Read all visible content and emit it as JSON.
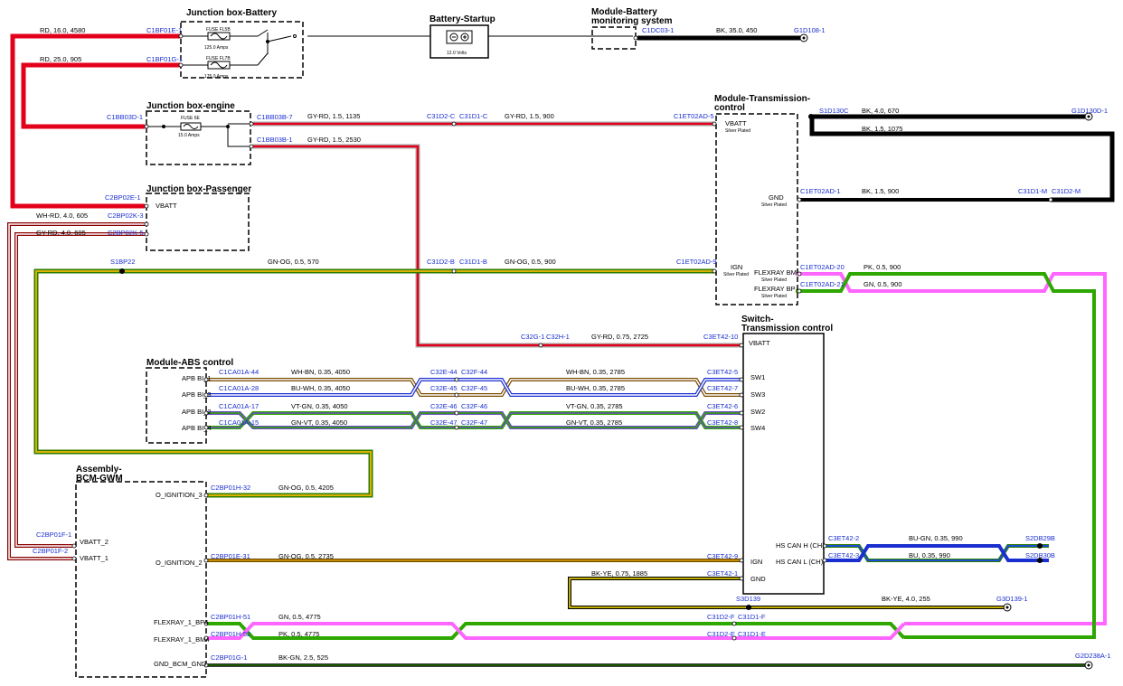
{
  "components": {
    "jb_battery": {
      "title": "Junction box-Battery",
      "fuse1": "FUSE FL5B",
      "amps1": "125.0 Amps",
      "fuse2": "FUSE FL7B",
      "amps2": "175.0 Amps"
    },
    "battery": {
      "title": "Battery-Startup",
      "volts": "12.0 Volts"
    },
    "bms": {
      "title1": "Module-Battery",
      "title2": "monitoring system"
    },
    "jb_engine": {
      "title": "Junction box-engine",
      "fuse": "FUSE 6E",
      "amps": "15.0 Amps"
    },
    "jb_passenger": {
      "title": "Junction box-Passenger",
      "pin": "VBATT"
    },
    "tcm": {
      "title1": "Module-Transmission-",
      "title2": "control",
      "vbatt": "VBATT",
      "gnd": "GND",
      "ign": "IGN",
      "fbm": "FLEXRAY BM",
      "fbp": "FLEXRAY BP",
      "silver": "Silver Plated"
    },
    "switch": {
      "title1": "Switch-",
      "title2": "Transmission control",
      "vbatt": "VBATT",
      "sw1": "SW1",
      "sw3": "SW3",
      "sw2": "SW2",
      "sw4": "SW4",
      "hsh": "HS CAN H (CH)",
      "hsl": "HS CAN L (CH)",
      "ign": "IGN",
      "gnd": "GND"
    },
    "abs": {
      "title": "Module-ABS control",
      "p1": "APB BI_1",
      "p3": "APB BI_3",
      "p2": "APB BI_2",
      "p4": "APB BI_4"
    },
    "bcm": {
      "title1": "Assembly-",
      "title2": "BCM-GWM",
      "ig3": "O_IGNITION_3",
      "vb2": "VBATT_2",
      "vb1": "VBATT_1",
      "ig2": "O_IGNITION_2",
      "bp4": "FLEXRAY_1_BP4",
      "bm4": "FLEXRAY_1_BM4",
      "gnd": "GND_BCM_GND"
    }
  },
  "connectors": {
    "c1bf01e1": "C1BF01E-1",
    "c1bf01g1": "C1BF01G-1",
    "c1dc031": "C1DC03-1",
    "g1d1081": "G1D108-1",
    "c1bb03d1": "C1BB03D-1",
    "c1bb03b7": "C1BB03B-7",
    "c1bb03b1": "C1BB03B-1",
    "c31d2c": "C31D2-C",
    "c31d1c": "C31D1-C",
    "c1et02ad5": "C1ET02AD-5",
    "s1d130c": "S1D130C",
    "g1d130d1": "G1D130D-1",
    "c1et02ad1": "C1ET02AD-1",
    "c31d1m": "C31D1-M",
    "c31d2m": "C31D2-M",
    "c2bp02e1": "C2BP02E-1",
    "c2bp02k3": "C2BP02K-3",
    "c2bp02k5": "C2BP02K-5",
    "s1bp22": "S1BP22",
    "c31d2b": "C31D2-B",
    "c31d1b": "C31D1-B",
    "c1et02ad9": "C1ET02AD-9",
    "c1et02ad20": "C1ET02AD-20",
    "c1et02ad21": "C1ET02AD-21",
    "c32g1": "C32G-1",
    "c32h1": "C32H-1",
    "c3et4210": "C3ET42-10",
    "c1ca01a44": "C1CA01A-44",
    "c1ca01a28": "C1CA01A-28",
    "c1ca01a17": "C1CA01A-17",
    "c1ca01a15": "C1CA01A-15",
    "c32e44": "C32E-44",
    "c32f44": "C32F-44",
    "c32e45": "C32E-45",
    "c32f45": "C32F-45",
    "c32e46": "C32E-46",
    "c32f46": "C32F-46",
    "c32e47": "C32E-47",
    "c32f47": "C32F-47",
    "c3et425": "C3ET42-5",
    "c3et427": "C3ET42-7",
    "c3et426": "C3ET42-6",
    "c3et428": "C3ET42-8",
    "c2bp01h32": "C2BP01H-32",
    "c2bp01f1": "C2BP01F-1",
    "c2bp01f2": "C2BP01F-2",
    "c2bp01e31": "C2BP01E-31",
    "c3et429": "C3ET42-9",
    "c3et421": "C3ET42-1",
    "c3et422": "C3ET42-2",
    "c3et423": "C3ET42-3",
    "s2db29b": "S2DB29B",
    "s2db30b": "S2DB30B",
    "s3d139": "S3D139",
    "g3d1391": "G3D139-1",
    "c2bp01h51": "C2BP01H-51",
    "c2bp01h52": "C2BP01H-52",
    "c31d2f": "C31D2-F",
    "c31d1f": "C31D1-F",
    "c31d2e": "C31D2-E",
    "c31d1e": "C31D1-E",
    "c2bp01g1": "C2BP01G-1",
    "g2d238a1": "G2D238A-1"
  },
  "wires": {
    "w1": "RD, 16.0, 4580",
    "w2": "RD, 25.0, 905",
    "w3": "BK, 35.0, 450",
    "w4": "GY-RD, 1.5, 1135",
    "w5": "GY-RD, 1.5, 900",
    "w6": "GY-RD, 1.5, 2530",
    "w7": "BK, 4.0, 670",
    "w8": "BK, 1.5, 1075",
    "w9": "BK, 1.5, 900",
    "w10": "WH-RD, 4.0, 605",
    "w11": "GY-RD, 4.0, 605",
    "w12": "GN-OG, 0.5, 570",
    "w13": "GN-OG, 0.5, 900",
    "w14": "PK, 0.5, 900",
    "w15": "GN, 0.5, 900",
    "w16": "GY-RD, 0.75, 2725",
    "w17": "WH-BN, 0.35, 4050",
    "w18": "WH-BN, 0.35, 2785",
    "w19": "BU-WH, 0.35, 4050",
    "w20": "BU-WH, 0.35, 2785",
    "w21": "VT-GN, 0.35, 4050",
    "w22": "VT-GN, 0.35, 2785",
    "w23": "GN-VT, 0.35, 4050",
    "w24": "GN-VT, 0.35, 2785",
    "w25": "GN-OG, 0.5, 4205",
    "w26": "GN-OG, 0.5, 2735",
    "w27": "BK-YE, 0.75, 1885",
    "w28": "BU-GN, 0.35, 990",
    "w29": "BU, 0.35, 990",
    "w30": "BK-YE, 4.0, 255",
    "w31": "GN, 0.5, 4775",
    "w32": "PK, 0.5, 4775",
    "w33": "BK-GN, 2.5, 525"
  }
}
